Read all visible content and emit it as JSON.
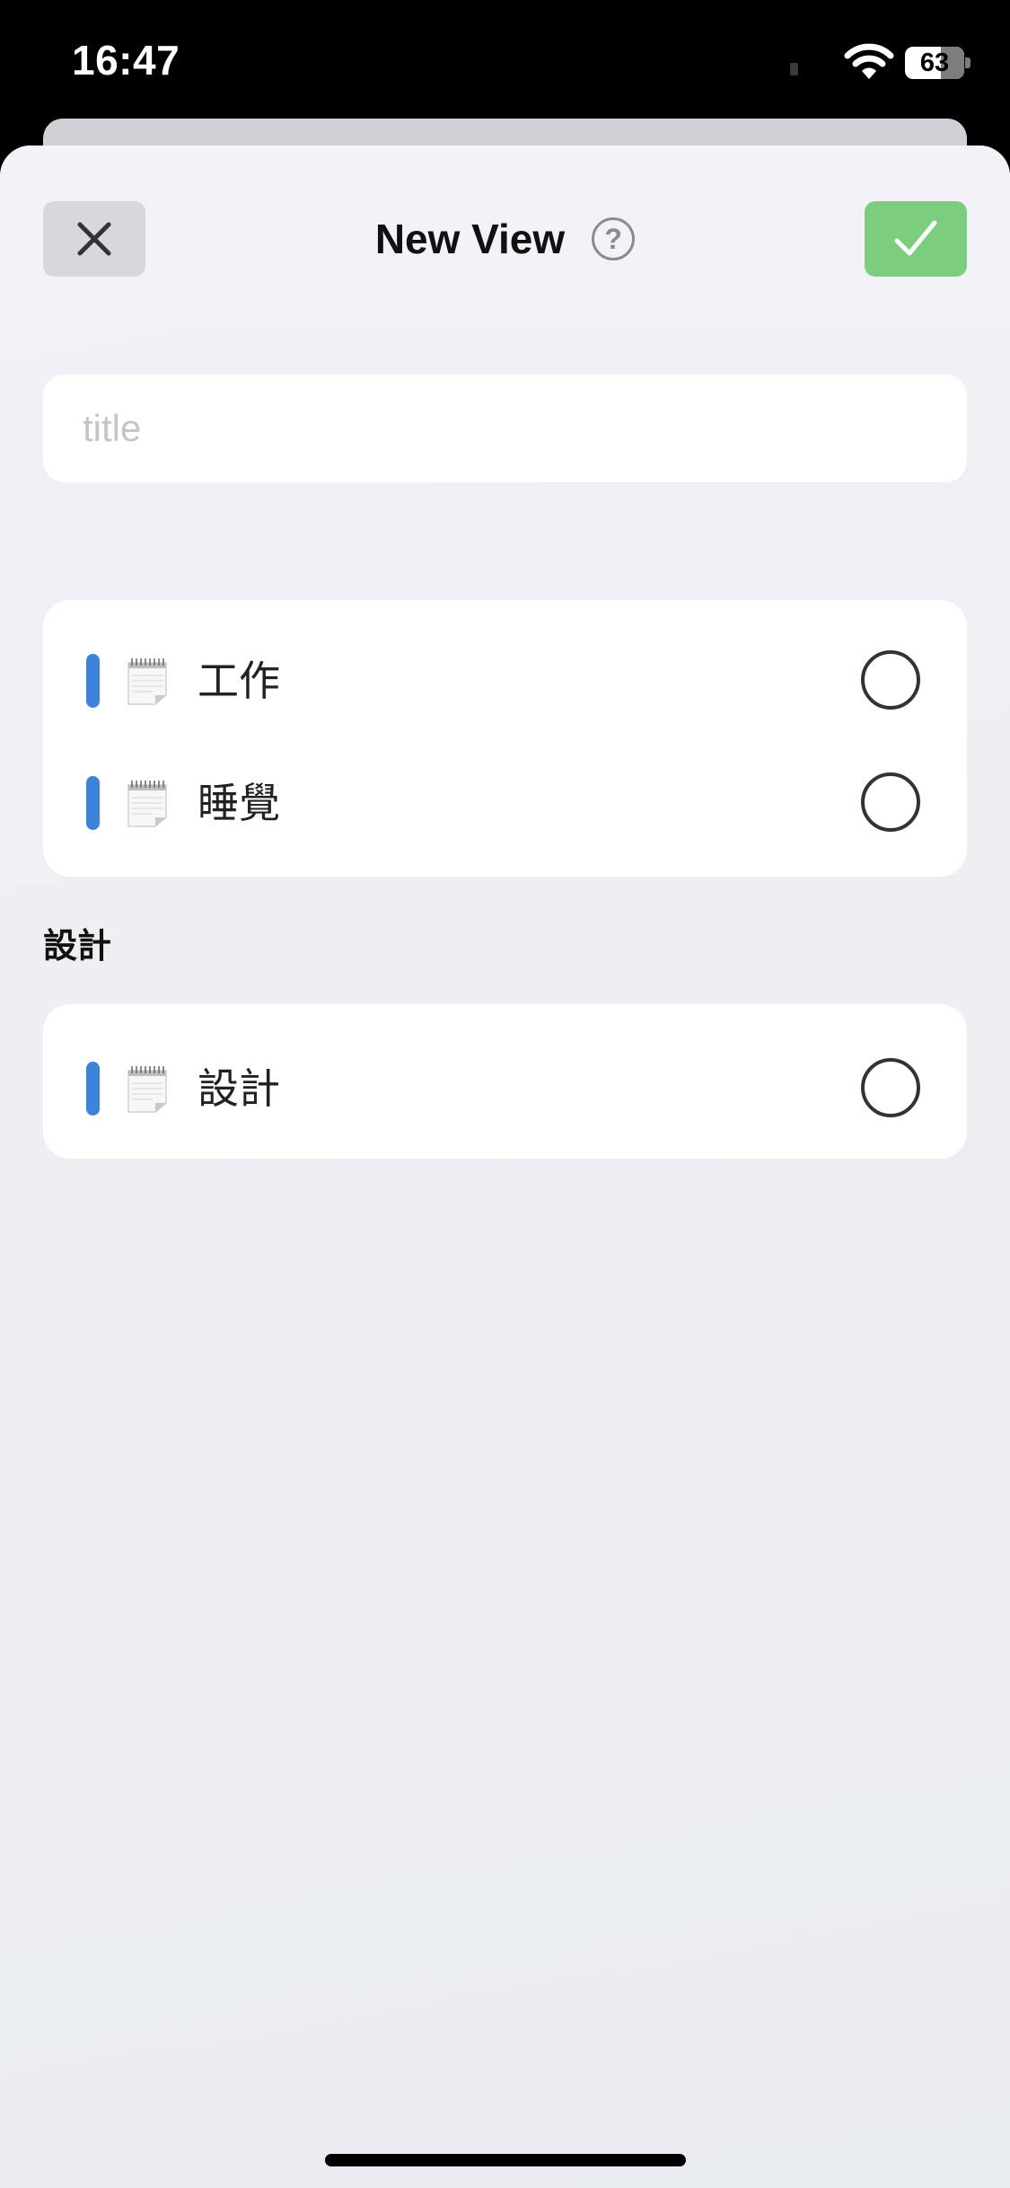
{
  "status_bar": {
    "time": "16:47",
    "battery": "63",
    "icons": [
      "cellular-icon",
      "wifi-icon",
      "battery-icon"
    ]
  },
  "nav": {
    "title": "New View",
    "help_icon": "?",
    "close_icon": "close-icon",
    "confirm_icon": "checkmark-icon"
  },
  "form": {
    "title_placeholder": "title",
    "title_value": ""
  },
  "groups": [
    {
      "header": "",
      "items": [
        {
          "label": "工作",
          "icon": "notepad-icon",
          "color": "#3D83D9",
          "selected": false
        },
        {
          "label": "睡覺",
          "icon": "notepad-icon",
          "color": "#3D83D9",
          "selected": false
        }
      ]
    },
    {
      "header": "設計",
      "items": [
        {
          "label": "設計",
          "icon": "notepad-icon",
          "color": "#3D83D9",
          "selected": false
        }
      ]
    }
  ],
  "colors": {
    "accent_bar": "#3D83D9",
    "confirm_button": "#7CCD7D",
    "close_button": "#D8D7DC",
    "sheet_background": "#F2F2F6"
  }
}
